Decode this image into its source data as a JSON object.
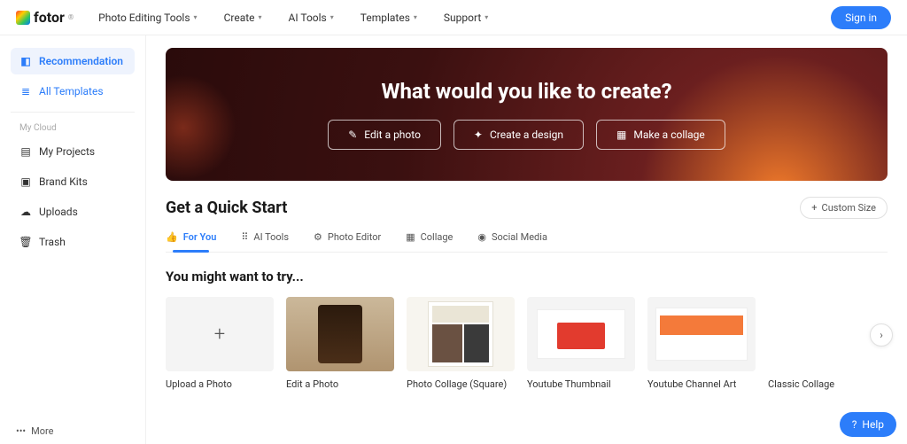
{
  "brand": {
    "name": "fotor"
  },
  "nav": {
    "items": [
      "Photo Editing Tools",
      "Create",
      "AI Tools",
      "Templates",
      "Support"
    ],
    "signin": "Sign in"
  },
  "sidebar": {
    "primary": [
      {
        "label": "Recommendation"
      },
      {
        "label": "All Templates"
      }
    ],
    "cloud_label": "My Cloud",
    "cloud": [
      {
        "label": "My Projects"
      },
      {
        "label": "Brand Kits"
      },
      {
        "label": "Uploads"
      },
      {
        "label": "Trash"
      }
    ],
    "more": "More"
  },
  "hero": {
    "title": "What would you like to create?",
    "buttons": [
      "Edit a photo",
      "Create a design",
      "Make a collage"
    ]
  },
  "quick": {
    "title": "Get a Quick Start",
    "custom": "Custom Size",
    "tabs": [
      "For You",
      "AI Tools",
      "Photo Editor",
      "Collage",
      "Social Media"
    ]
  },
  "try": {
    "title": "You might want to try...",
    "cards": [
      {
        "label": "Upload a Photo"
      },
      {
        "label": "Edit a Photo"
      },
      {
        "label": "Photo Collage (Square)"
      },
      {
        "label": "Youtube Thumbnail"
      },
      {
        "label": "Youtube Channel Art"
      },
      {
        "label": "Classic Collage"
      }
    ]
  },
  "help": "Help"
}
